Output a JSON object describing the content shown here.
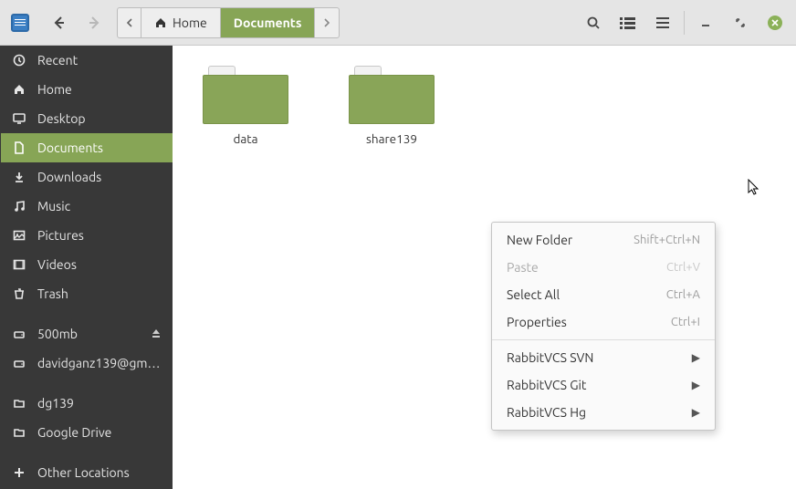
{
  "toolbar": {
    "back_enabled": true,
    "forward_enabled": false
  },
  "path": {
    "home_label": "Home",
    "current_label": "Documents"
  },
  "sidebar": {
    "primary": [
      {
        "icon": "clock",
        "label": "Recent"
      },
      {
        "icon": "home",
        "label": "Home"
      },
      {
        "icon": "desktop",
        "label": "Desktop"
      },
      {
        "icon": "document",
        "label": "Documents",
        "selected": true
      },
      {
        "icon": "download",
        "label": "Downloads"
      },
      {
        "icon": "music",
        "label": "Music"
      },
      {
        "icon": "picture",
        "label": "Pictures"
      },
      {
        "icon": "video",
        "label": "Videos"
      },
      {
        "icon": "trash",
        "label": "Trash"
      }
    ],
    "devices": [
      {
        "icon": "drive",
        "label": "500mb",
        "eject": true
      },
      {
        "icon": "drive",
        "label": "davidganz139@gm…"
      }
    ],
    "bookmarks": [
      {
        "icon": "folder",
        "label": "dg139"
      },
      {
        "icon": "folder",
        "label": "Google Drive"
      }
    ],
    "other_label": "Other Locations"
  },
  "folders": [
    {
      "name": "data"
    },
    {
      "name": "share139"
    }
  ],
  "context_menu": {
    "items": [
      {
        "label": "New Folder",
        "shortcut": "Shift+Ctrl+N"
      },
      {
        "label": "Paste",
        "shortcut": "Ctrl+V",
        "disabled": true
      },
      {
        "label": "Select All",
        "shortcut": "Ctrl+A"
      },
      {
        "label": "Properties",
        "shortcut": "Ctrl+I"
      }
    ],
    "submenu_items": [
      {
        "label": "RabbitVCS SVN"
      },
      {
        "label": "RabbitVCS Git"
      },
      {
        "label": "RabbitVCS Hg"
      }
    ]
  }
}
